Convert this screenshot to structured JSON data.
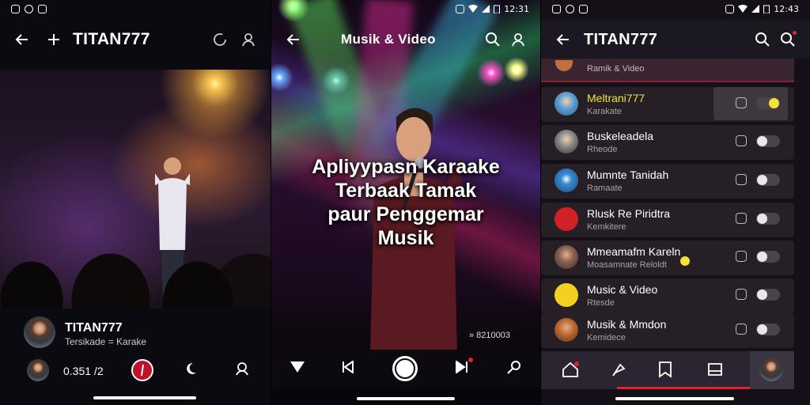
{
  "panel1": {
    "status_right": "",
    "app_title": "TITAN777",
    "channel_name": "TITAN777",
    "channel_sub": "Tersikade = Karake",
    "count": "0.351 /2"
  },
  "panel2": {
    "status_time": "12:31",
    "app_title": "Musik & Video",
    "overlay_lines": [
      "Apliyypasn Karaake",
      "Terbaak Tamak",
      "paur Penggemar",
      "Musik"
    ],
    "views": "» 8210003"
  },
  "panel3": {
    "status_time": "12:43",
    "app_title": "TITAN777",
    "top_sub": "Ramik & Video",
    "rows": [
      {
        "name": "Meltrani777",
        "sub": "Karakate",
        "name_color": "#f5e23a",
        "toggle": "on"
      },
      {
        "name": "Buskeleadela",
        "sub": "Rheode",
        "name_color": "#ffffff",
        "toggle": "off"
      },
      {
        "name": "Mumnte Tanidah",
        "sub": "Ramaate",
        "name_color": "#ffffff",
        "toggle": "off"
      },
      {
        "name": "Rlusk Re Piridtra",
        "sub": "Kemkitere",
        "name_color": "#ffffff",
        "toggle": "off"
      },
      {
        "name": "Mmeamafm Kareln",
        "sub": "Moasamnate Reloldt",
        "name_color": "#ffffff",
        "toggle": "off"
      },
      {
        "name": "Music & Video",
        "sub": "Rtesde",
        "name_color": "#ffffff",
        "toggle": "off"
      },
      {
        "name": "Musik & Mmdon",
        "sub": "Kemidece",
        "name_color": "#ffffff",
        "toggle": "off"
      }
    ]
  },
  "colors": {
    "accent_red": "#e0202e",
    "toggle_on": "#f5e23a"
  }
}
